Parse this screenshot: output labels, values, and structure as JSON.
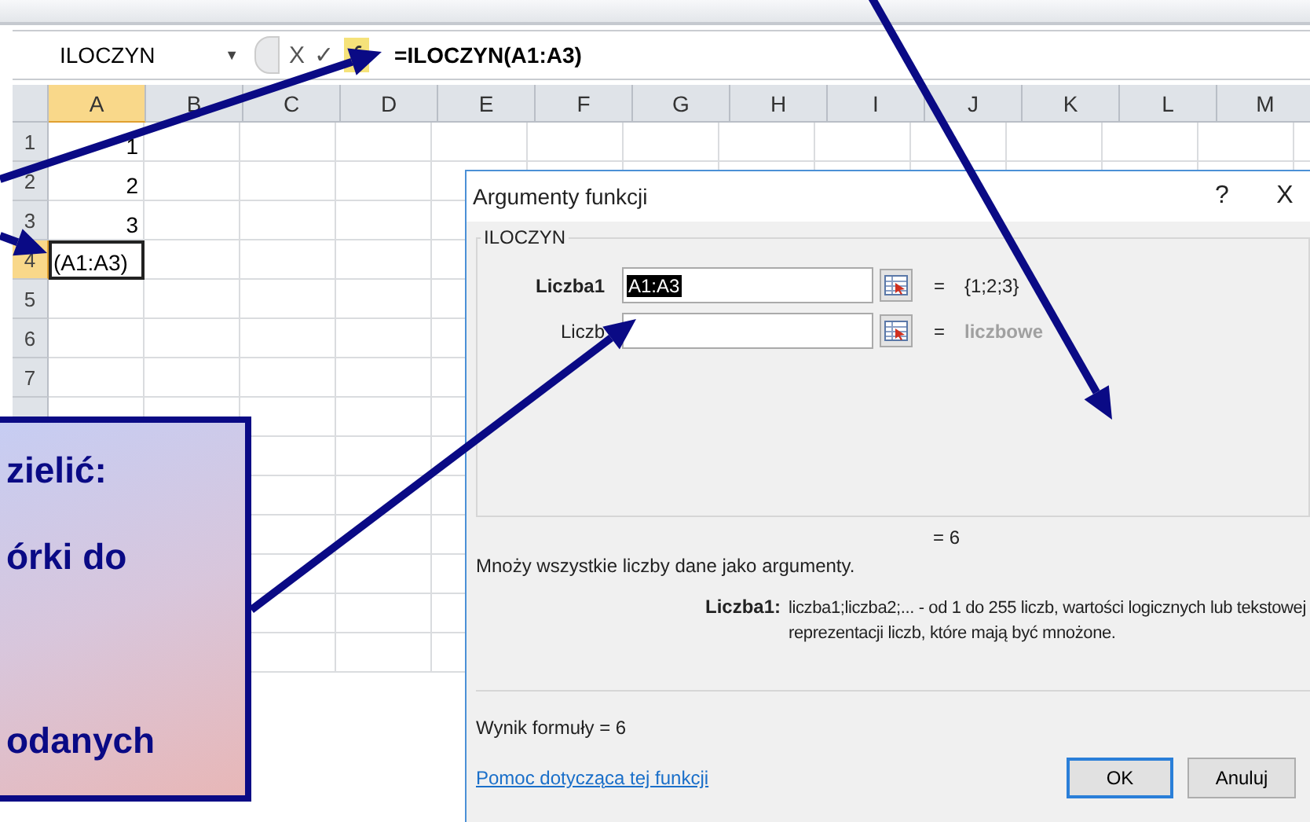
{
  "formula_bar": {
    "name_box": "ILOCZYN",
    "dropdown": "▼",
    "cancel": "X",
    "enter": "✓",
    "formula": "=ILOCZYN(A1:A3)"
  },
  "sheet": {
    "columns": [
      {
        "label": "A",
        "selected": true
      },
      {
        "label": "B",
        "selected": false
      },
      {
        "label": "C",
        "selected": false
      },
      {
        "label": "D",
        "selected": false
      },
      {
        "label": "E",
        "selected": false
      },
      {
        "label": "F",
        "selected": false
      },
      {
        "label": "G",
        "selected": false
      },
      {
        "label": "H",
        "selected": false
      },
      {
        "label": "I",
        "selected": false
      },
      {
        "label": "J",
        "selected": false
      },
      {
        "label": "K",
        "selected": false
      },
      {
        "label": "L",
        "selected": false
      },
      {
        "label": "M",
        "selected": false
      }
    ],
    "rows": [
      {
        "label": "1",
        "selected": false,
        "value": "1"
      },
      {
        "label": "2",
        "selected": false,
        "value": "2"
      },
      {
        "label": "3",
        "selected": false,
        "value": "3"
      },
      {
        "label": "4",
        "selected": true,
        "value": "(A1:A3)"
      },
      {
        "label": "5",
        "selected": false
      },
      {
        "label": "6",
        "selected": false
      },
      {
        "label": "7",
        "selected": false
      }
    ]
  },
  "dialog": {
    "title": "Argumenty funkcji",
    "help": "?",
    "close": "X",
    "function_name": "ILOCZYN",
    "arguments": [
      {
        "label": "Liczba1",
        "value": "A1:A3",
        "equals": "=",
        "result": "{1;2;3}",
        "bold": true,
        "hint": false
      },
      {
        "label": "Liczb",
        "equals": "=",
        "result": "liczbowe",
        "bold": false,
        "hint": true
      }
    ],
    "result_line": "=  6",
    "description": "Mnoży wszystkie liczby dane jako argumenty.",
    "argument_help_label": "Liczba1:",
    "argument_help": "liczba1;liczba2;... - od 1 do 255 liczb, wartości logicznych lub tekstowej reprezentacji liczb, które mają być mnożone.",
    "formula_result": "Wynik formuły =  6",
    "help_link": "Pomoc dotycząca tej funkcji",
    "buttons": [
      "OK",
      "Anuluj"
    ]
  },
  "callout": {
    "lines": [
      "zielić:",
      "órki do",
      "odanych"
    ]
  }
}
